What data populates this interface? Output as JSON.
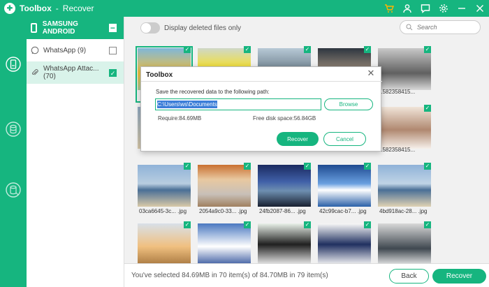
{
  "titlebar": {
    "logo": "toolbox-logo",
    "app": "Toolbox",
    "separator": "-",
    "page": "Recover",
    "icons": [
      "cart-icon",
      "user-icon",
      "feedback-icon",
      "settings-icon",
      "minimize-icon",
      "close-icon"
    ]
  },
  "rail": {
    "icons": [
      "device-recover-icon",
      "database-icon",
      "backup-icon"
    ]
  },
  "device": {
    "name": "SAMSUNG ANDROID",
    "collapse": "−",
    "items": [
      {
        "icon": "whatsapp-icon",
        "label": "WhatsApp (9)",
        "checked": false
      },
      {
        "icon": "attachment-icon",
        "label": "WhatsApp Attac... (70)",
        "checked": true
      }
    ]
  },
  "toolbar": {
    "toggle_label": "Display deleted files only",
    "search_placeholder": "Search"
  },
  "grid": {
    "check": "✓",
    "captions": [
      "",
      "",
      "",
      "",
      "",
      "",
      "",
      "",
      "",
      "",
      "03ca6645-3c... .jpg",
      "2054a9c0-33... .jpg",
      "24fb2087-86... .jpg",
      "42c99cac-b7... .jpg",
      "4bd918ac-28... .jpg",
      "",
      "",
      "",
      "",
      ""
    ],
    "obscured_captions": [
      "1582358415...",
      "1582358415..."
    ]
  },
  "bottom": {
    "status": "You've selected 84.69MB in 70 item(s) of 84.70MB in 79 item(s)",
    "back": "Back",
    "recover": "Recover"
  },
  "dialog": {
    "title": "Toolbox",
    "close": "✕",
    "prompt": "Save the recovered data to the following path:",
    "path": "C:\\Users\\ws\\Documents",
    "browse": "Browse",
    "require": "Require:84.69MB",
    "free": "Free disk space:56.84GB",
    "recover": "Recover",
    "cancel": "Cancel"
  },
  "colors": {
    "accent": "#16b57f",
    "selection": "#3b7dd8"
  }
}
